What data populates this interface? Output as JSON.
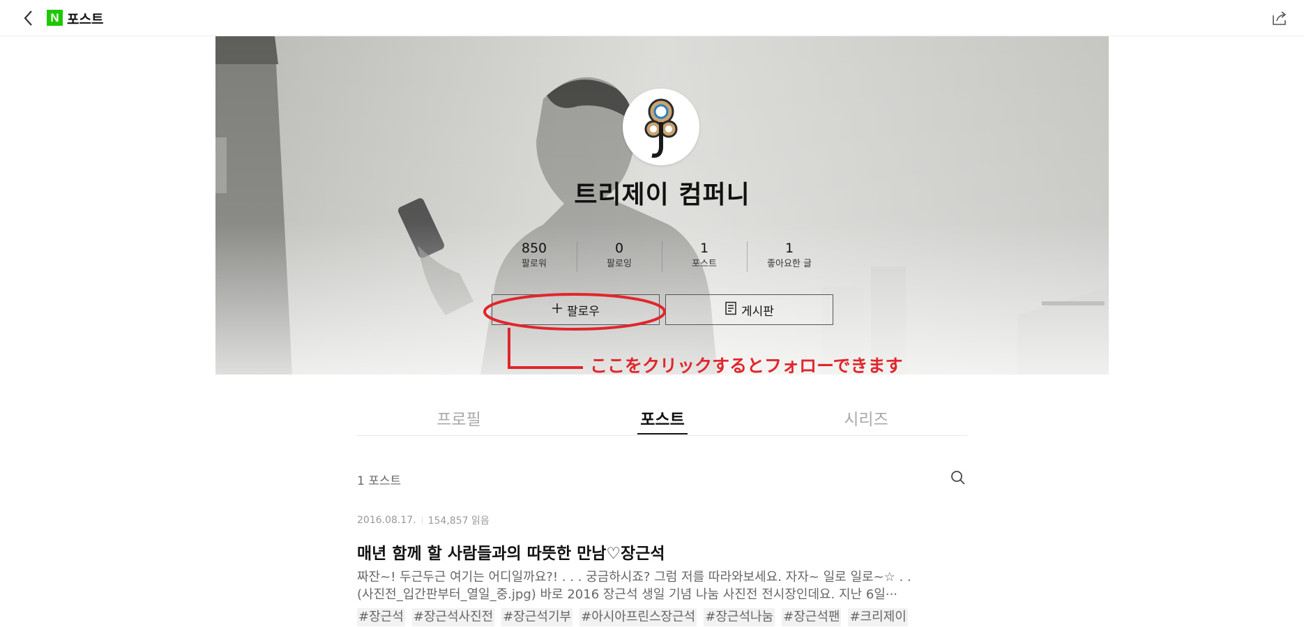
{
  "topbar": {
    "logo_letter": "N",
    "title": "포스트"
  },
  "profile": {
    "name": "트리제이 컴퍼니",
    "stats": [
      {
        "value": "850",
        "label": "팔로워"
      },
      {
        "value": "0",
        "label": "팔로잉"
      },
      {
        "value": "1",
        "label": "포스트"
      },
      {
        "value": "1",
        "label": "좋아요한 글"
      }
    ],
    "follow_label": "팔로우",
    "board_label": "게시판"
  },
  "annotation": {
    "text": "ここをクリックするとフォローできます",
    "color": "#e0262c"
  },
  "tabs": [
    {
      "label": "프로필",
      "active": false
    },
    {
      "label": "포스트",
      "active": true
    },
    {
      "label": "시리즈",
      "active": false
    }
  ],
  "post_list": {
    "count_label": "1 포스트",
    "posts": [
      {
        "date": "2016.08.17.",
        "views": "154,857 읽음",
        "title": "매년 함께 할 사람들과의 따뜻한 만남♡장근석",
        "summary_line1": "짜잔~! 두근두근 여기는 어디일까요?! . . . 궁금하시죠? 그럼 저를 따라와보세요. 자자~ 일로 일로~☆ . .",
        "summary_line2": "(사진전_입간판부터_열일_중.jpg) 바로 2016 장근석 생일 기념 나눔 사진전 전시장인데요. 지난 6일···",
        "tags": [
          "#장근석",
          "#장근석사진전",
          "#장근석기부",
          "#아시아프린스장근석",
          "#장근석나눔",
          "#장근석팬",
          "#크리제이"
        ]
      }
    ]
  },
  "colors": {
    "naver_green": "#1ec800",
    "annotation_red": "#e0262c"
  }
}
